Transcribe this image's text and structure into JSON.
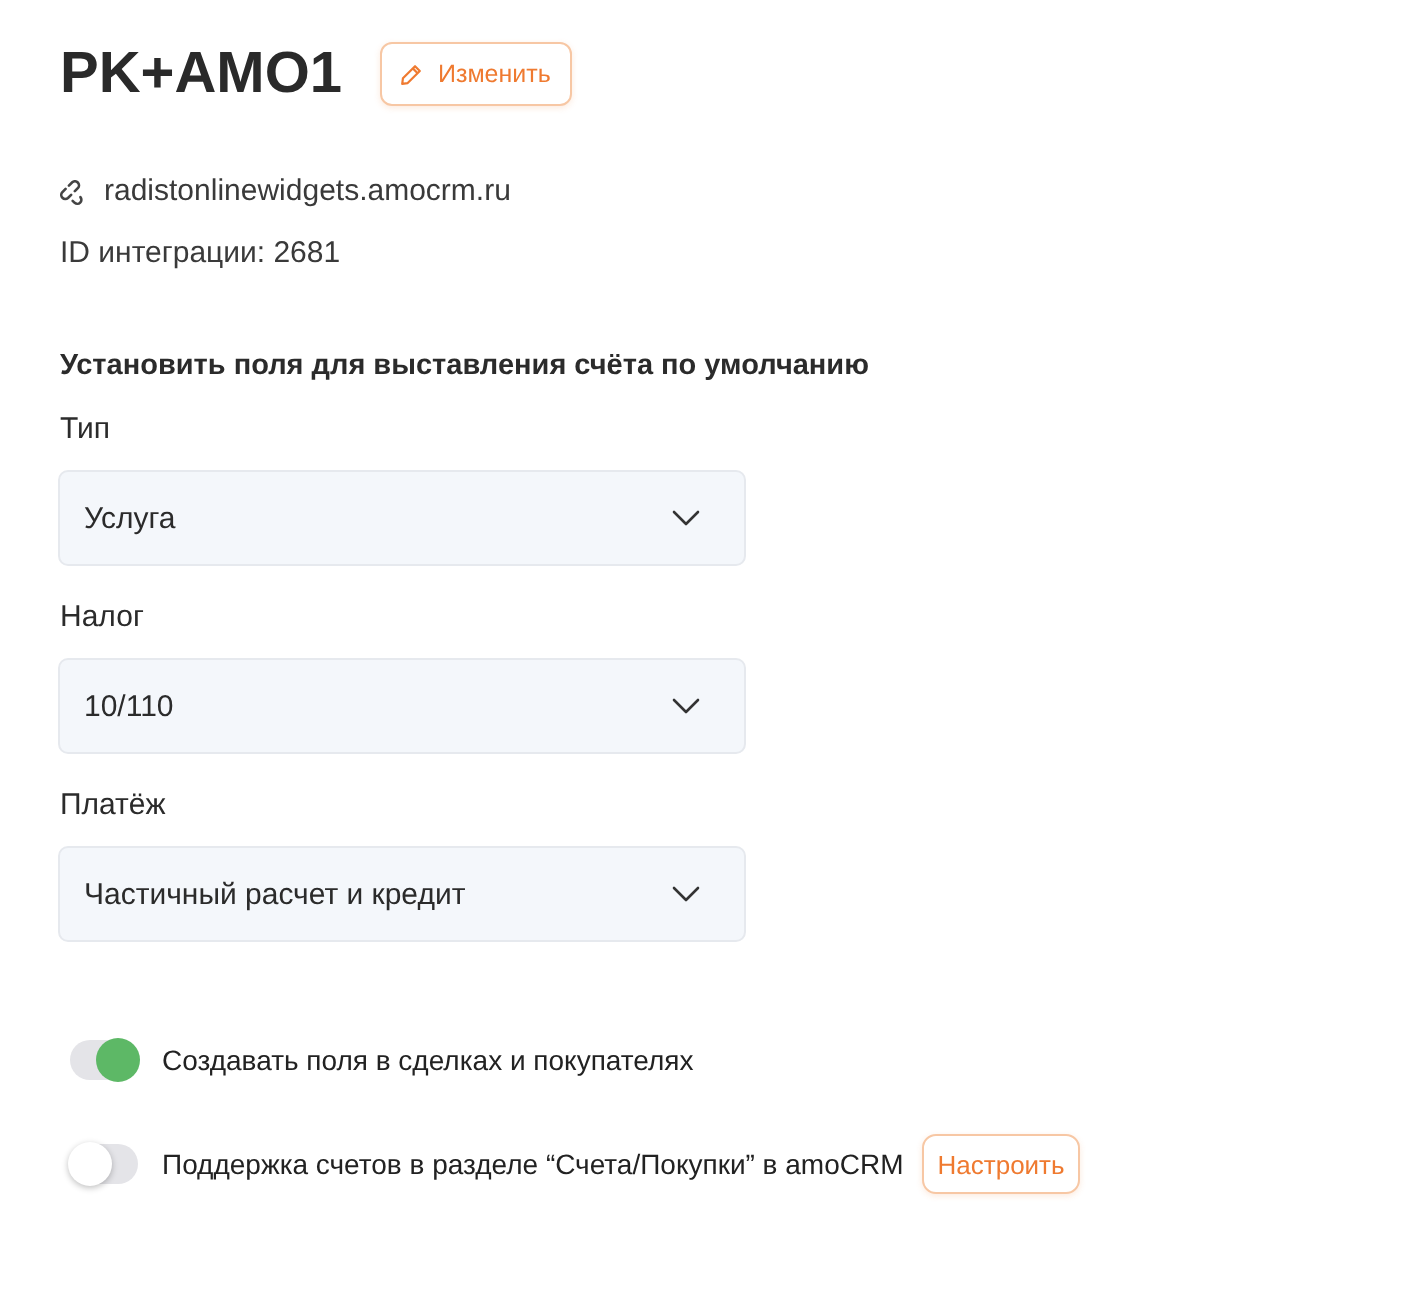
{
  "header": {
    "title": "PK+AMO1",
    "edit_button": "Изменить"
  },
  "info": {
    "domain": "radistonlinewidgets.amocrm.ru",
    "integration_id": "ID интеграции: 2681"
  },
  "defaults": {
    "heading": "Установить поля для выставления счёта по умолчанию",
    "fields": [
      {
        "label": "Тип",
        "value": "Услуга"
      },
      {
        "label": "Налог",
        "value": "10/110"
      },
      {
        "label": "Платёж",
        "value": "Частичный расчет и кредит"
      }
    ]
  },
  "toggles": [
    {
      "label": "Создавать поля в сделках и покупателях",
      "on": true
    },
    {
      "label": "Поддержка счетов в разделе “Счета/Покупки” в amoCRM",
      "on": false,
      "button": "Настроить"
    }
  ]
}
